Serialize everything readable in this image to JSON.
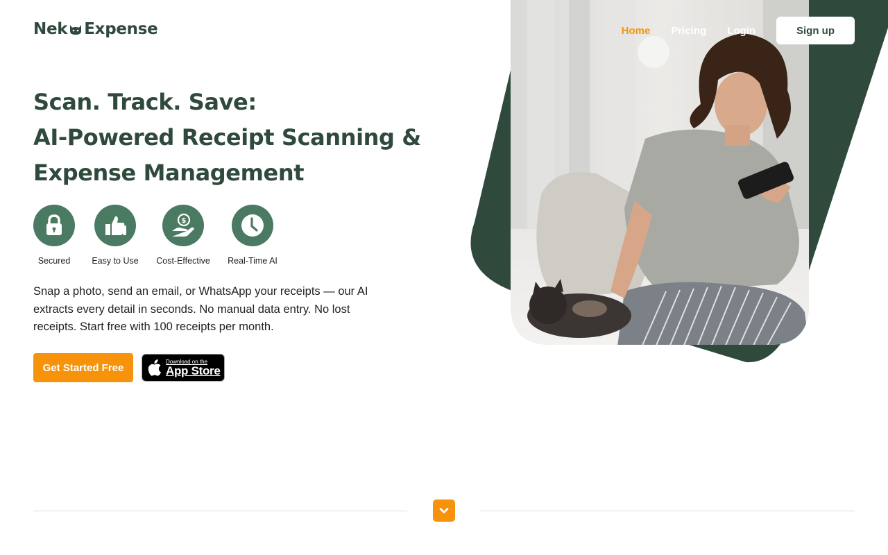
{
  "brand": {
    "name_left": "Nek",
    "name_right": "Expense"
  },
  "nav": {
    "home": "Home",
    "pricing": "Pricing",
    "login": "Login",
    "signup": "Sign up"
  },
  "hero": {
    "headline_line1": "Scan. Track. Save:",
    "headline_line2": "AI-Powered Receipt Scanning &",
    "headline_line3": "Expense Management",
    "description": "Snap a photo, send an email, or WhatsApp your receipts — our AI extracts every detail in seconds. No manual data entry. No lost receipts. Start free with 100 receipts per month.",
    "cta_label": "Get Started Free",
    "appstore_small": "Download on the",
    "appstore_big": "App Store"
  },
  "features": [
    {
      "label": "Secured",
      "icon": "lock-icon"
    },
    {
      "label": "Easy to Use",
      "icon": "thumbs-up-icon"
    },
    {
      "label": "Cost-Effective",
      "icon": "money-hand-icon"
    },
    {
      "label": "Real-Time AI",
      "icon": "clock-icon"
    }
  ],
  "colors": {
    "brand_green": "#2f4a3c",
    "icon_green": "#4a7a61",
    "accent_orange": "#f7930a"
  }
}
